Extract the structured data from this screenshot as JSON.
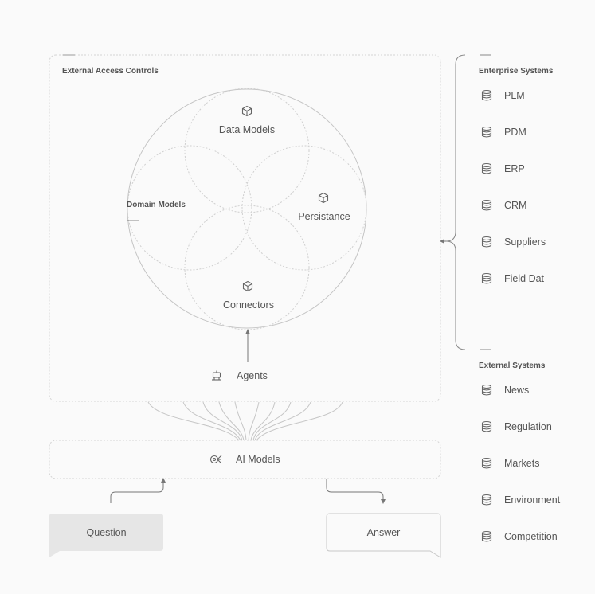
{
  "external_access": {
    "title": "External Access Controls"
  },
  "core": {
    "data_models": "Data Models",
    "persistance": "Persistance",
    "connectors": "Connectors",
    "domain_models": "Domain Models"
  },
  "agents": {
    "label": "Agents"
  },
  "ai_models": {
    "label": "AI Models"
  },
  "question": {
    "label": "Question"
  },
  "answer": {
    "label": "Answer"
  },
  "enterprise": {
    "title": "Enterprise Systems",
    "items": [
      {
        "label": "PLM",
        "icon": "database-icon"
      },
      {
        "label": "PDM",
        "icon": "database-icon"
      },
      {
        "label": "ERP",
        "icon": "database-icon"
      },
      {
        "label": "CRM",
        "icon": "database-icon"
      },
      {
        "label": "Suppliers",
        "icon": "database-icon"
      },
      {
        "label": "Field Dat",
        "icon": "database-icon"
      }
    ]
  },
  "external": {
    "title": "External Systems",
    "items": [
      {
        "label": "News",
        "icon": "database-icon"
      },
      {
        "label": "Regulation",
        "icon": "database-icon"
      },
      {
        "label": "Markets",
        "icon": "database-icon"
      },
      {
        "label": "Environment",
        "icon": "database-icon"
      },
      {
        "label": "Competition",
        "icon": "database-icon"
      }
    ]
  },
  "colors": {
    "line": "#c8c8c8",
    "dash": "#cfcfcf",
    "text": "#555555",
    "bubble_fill": "#e6e6e6"
  }
}
